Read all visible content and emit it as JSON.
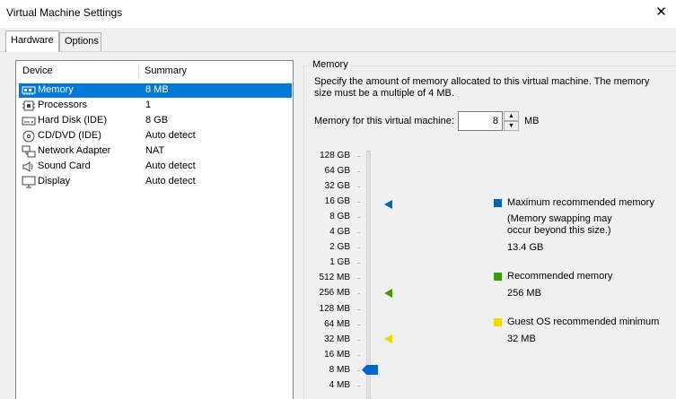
{
  "window": {
    "title": "Virtual Machine Settings",
    "close_glyph": "✕"
  },
  "tabs": [
    {
      "label": "Hardware",
      "active": true
    },
    {
      "label": "Options",
      "active": false
    }
  ],
  "device_list": {
    "columns": [
      "Device",
      "Summary"
    ],
    "rows": [
      {
        "name": "Memory",
        "summary": "8 MB",
        "icon": "memory-icon",
        "selected": true
      },
      {
        "name": "Processors",
        "summary": "1",
        "icon": "processor-icon"
      },
      {
        "name": "Hard Disk (IDE)",
        "summary": "8 GB",
        "icon": "hard-disk-icon"
      },
      {
        "name": "CD/DVD (IDE)",
        "summary": "Auto detect",
        "icon": "cd-dvd-icon"
      },
      {
        "name": "Network Adapter",
        "summary": "NAT",
        "icon": "network-adapter-icon"
      },
      {
        "name": "Sound Card",
        "summary": "Auto detect",
        "icon": "speaker-icon"
      },
      {
        "name": "Display",
        "summary": "Auto detect",
        "icon": "monitor-icon"
      }
    ]
  },
  "memory": {
    "group_title": "Memory",
    "description": "Specify the amount of memory allocated to this virtual machine. The memory size must be a multiple of 4 MB.",
    "field_label": "Memory for this virtual machine:",
    "value": "8",
    "unit": "MB",
    "scale": [
      "128 GB",
      "64 GB",
      "32 GB",
      "16 GB",
      "8 GB",
      "4 GB",
      "2 GB",
      "1 GB",
      "512 MB",
      "256 MB",
      "128 MB",
      "64 MB",
      "32 MB",
      "16 MB",
      "8 MB",
      "4 MB"
    ],
    "legend": {
      "max": {
        "label": "Maximum recommended memory",
        "note": "(Memory swapping may occur beyond this size.)",
        "value": "13.4 GB",
        "color": "#0063b1"
      },
      "recommended": {
        "label": "Recommended memory",
        "value": "256 MB",
        "color": "#3d9b12"
      },
      "guest_min": {
        "label": "Guest OS recommended minimum",
        "value": "32 MB",
        "color": "#f2d600"
      }
    }
  }
}
